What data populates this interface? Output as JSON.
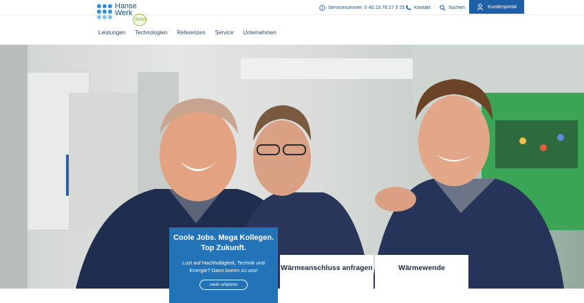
{
  "header": {
    "logo": {
      "line1": "Hanse",
      "line2": "Werk",
      "badge": "Natur"
    },
    "service_number": "Servicenummer: 0 40 23 78 27 3 25",
    "contact": "Kontakt",
    "search": "Suchen",
    "portal": "Kundenportal",
    "brand_color": "#1f5fa8"
  },
  "nav": {
    "items": [
      "Leistungen",
      "Technologien",
      "Referenzen",
      "Service",
      "Unternehmen"
    ]
  },
  "hero": {
    "promo": {
      "title": "Coole Jobs. Mega Kollegen. Top Zukunft.",
      "text": "Lust auf Nachhaltigkeit, Technik und Energie? Dann komm zu uns!",
      "cta": "mehr erfahren"
    },
    "tiles": [
      "Wärmeanschluss anfragen",
      "Wärmewende"
    ]
  }
}
